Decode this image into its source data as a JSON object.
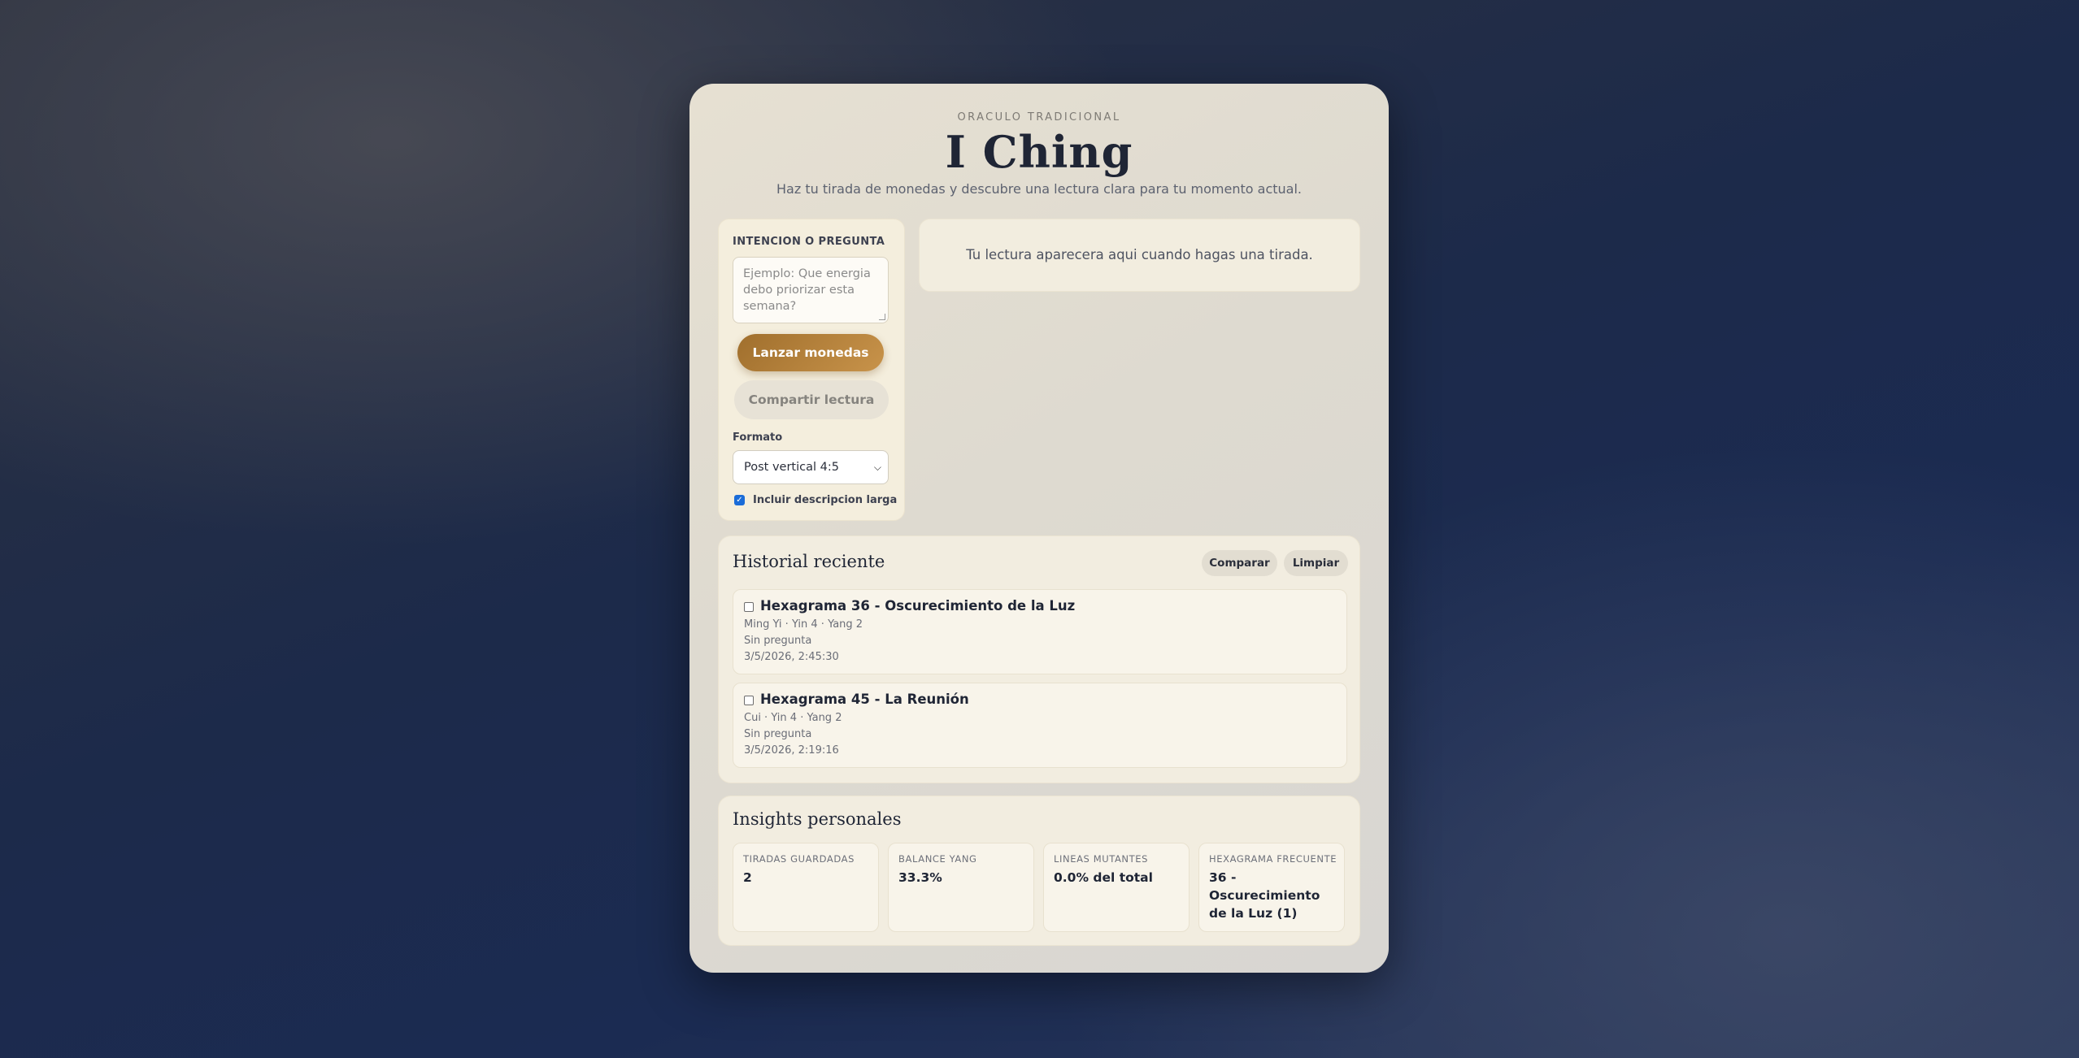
{
  "header": {
    "eyebrow": "ORACULO TRADICIONAL",
    "title": "I Ching",
    "subtitle": "Haz tu tirada de monedas y descubre una lectura clara para tu momento actual."
  },
  "controls": {
    "question_label": "INTENCION O PREGUNTA",
    "question_placeholder": "Ejemplo: Que energia debo priorizar esta semana?",
    "cast_button": "Lanzar monedas",
    "share_button": "Compartir lectura",
    "format_label": "Formato",
    "format_selected": "Post vertical 4:5",
    "long_description_label": "Incluir descripcion larga",
    "long_description_checked": true
  },
  "result": {
    "empty_text": "Tu lectura aparecera aqui cuando hagas una tirada."
  },
  "history": {
    "title": "Historial reciente",
    "compare_button": "Comparar",
    "clear_button": "Limpiar",
    "entries": [
      {
        "title": "Hexagrama 36 - Oscurecimiento de la Luz",
        "meta": "Ming Yi · Yin 4 · Yang 2",
        "question": "Sin pregunta",
        "date": "3/5/2026, 2:45:30"
      },
      {
        "title": "Hexagrama 45 - La Reunión",
        "meta": "Cui · Yin 4 · Yang 2",
        "question": "Sin pregunta",
        "date": "3/5/2026, 2:19:16"
      }
    ]
  },
  "insights": {
    "title": "Insights personales",
    "stats": [
      {
        "label": "TIRADAS GUARDADAS",
        "value": "2"
      },
      {
        "label": "BALANCE YANG",
        "value": "33.3%"
      },
      {
        "label": "LINEAS MUTANTES",
        "value": "0.0% del total"
      },
      {
        "label": "HEXAGRAMA FRECUENTE",
        "value": "36 - Oscurecimiento de la Luz (1)"
      }
    ]
  },
  "colors": {
    "accent": "#b07f3a",
    "checkbox": "#1a6cd8"
  }
}
